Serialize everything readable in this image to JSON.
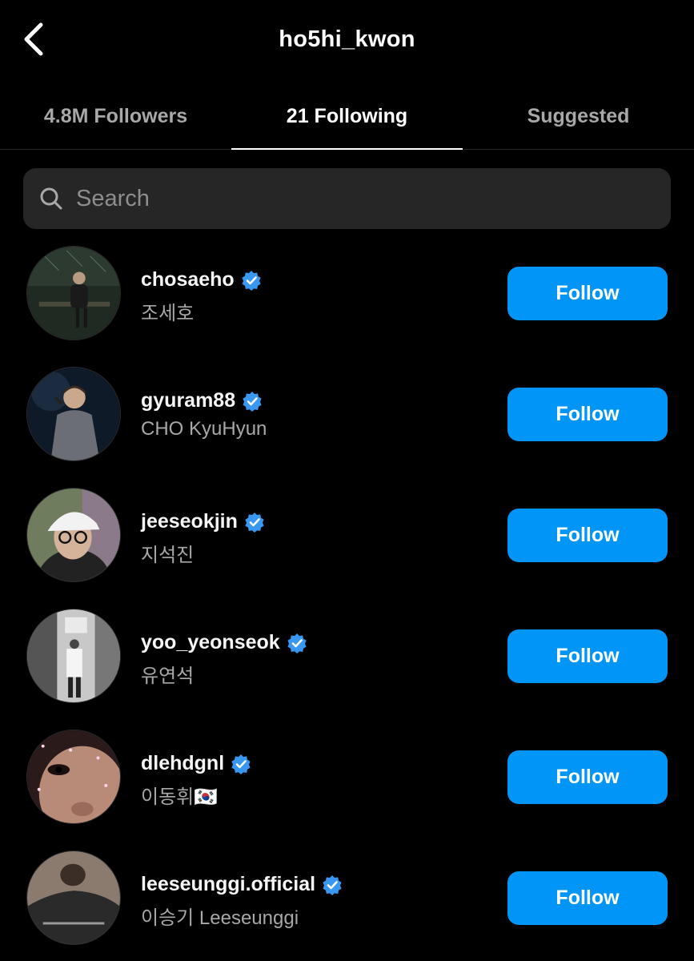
{
  "header": {
    "title": "ho5hi_kwon",
    "back_icon": "chevron-left-icon"
  },
  "tabs": [
    {
      "label": "4.8M Followers",
      "active": false
    },
    {
      "label": "21 Following",
      "active": true
    },
    {
      "label": "Suggested",
      "active": false
    }
  ],
  "search": {
    "placeholder": "Search",
    "value": "",
    "icon": "search-icon"
  },
  "accounts": [
    {
      "username": "chosaeho",
      "full_name": "조세호",
      "verified": true,
      "button": "Follow"
    },
    {
      "username": "gyuram88",
      "full_name": "CHO KyuHyun",
      "verified": true,
      "button": "Follow"
    },
    {
      "username": "jeeseokjin",
      "full_name": "지석진",
      "verified": true,
      "button": "Follow"
    },
    {
      "username": "yoo_yeonseok",
      "full_name": "유연석",
      "verified": true,
      "button": "Follow"
    },
    {
      "username": "dlehdgnl",
      "full_name": "이동휘🇰🇷",
      "verified": true,
      "button": "Follow"
    },
    {
      "username": "leeseunggi.official",
      "full_name": "이승기 Leeseunggi",
      "verified": true,
      "button": "Follow"
    }
  ],
  "colors": {
    "background": "#000000",
    "follow_button": "#0095f6",
    "verified_badge": "#3897f0",
    "secondary_text": "#a8a8a8",
    "search_bg": "#262626"
  }
}
